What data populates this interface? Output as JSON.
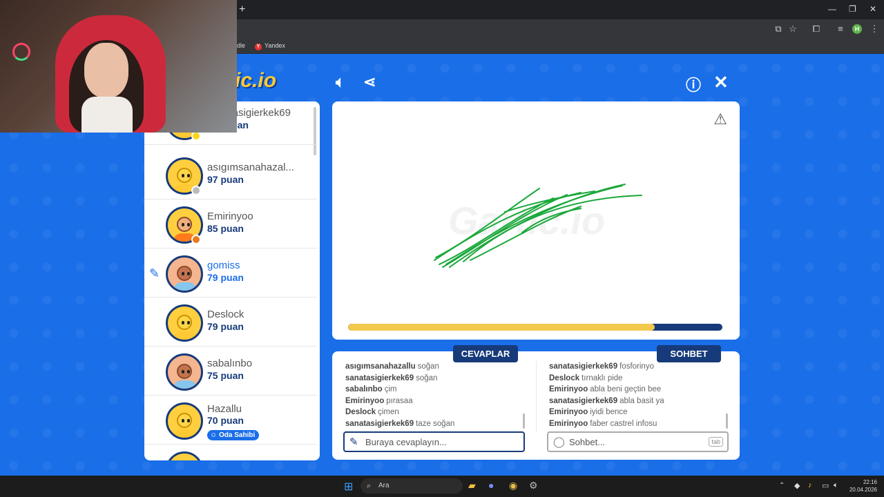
{
  "browser": {
    "bookmarks": [
      "dle",
      "Yandex"
    ],
    "profile_initial": "H"
  },
  "game": {
    "logo": "ic.io",
    "watermark": "Gartic.io",
    "progress_fraction": 0.82
  },
  "players": [
    {
      "name": "sanatasigierkek69",
      "points": "112 puan",
      "status_color": "#ffd51a"
    },
    {
      "name": "asıgımsanahazal...",
      "points": "97 puan",
      "status_color": "#bbbbbb"
    },
    {
      "name": "Emirinyoo",
      "points": "85 puan",
      "status_color": "#e87a1a"
    },
    {
      "name": "gomiss",
      "points": "79 puan",
      "drawing": true
    },
    {
      "name": "Deslock",
      "points": "79 puan"
    },
    {
      "name": "sabalınbo",
      "points": "75 puan"
    },
    {
      "name": "Hazallu",
      "points": "70 puan",
      "badge": "Oda Sahibi"
    }
  ],
  "answers": {
    "tab_label": "CEVAPLAR",
    "placeholder": "Buraya cevaplayın...",
    "messages": [
      {
        "who": "asıgımsanahazallu",
        "text": "soğan"
      },
      {
        "who": "sanatasigierkek69",
        "text": "soğan"
      },
      {
        "who": "sabalınbo",
        "text": "çim"
      },
      {
        "who": "Emirinyoo",
        "text": "pırasaa"
      },
      {
        "who": "Deslock",
        "text": "çimen"
      },
      {
        "who": "sanatasigierkek69",
        "text": "taze soğan"
      }
    ]
  },
  "chat": {
    "tab_label": "SOHBET",
    "placeholder": "Sohbet...",
    "tab_hint": "tab",
    "messages": [
      {
        "who": "sanatasigierkek69",
        "text": "fosforinyo"
      },
      {
        "who": "Deslock",
        "text": "tırnaklı pide"
      },
      {
        "who": "Emirinyoo",
        "text": "abla beni geçtin bee"
      },
      {
        "who": "sanatasigierkek69",
        "text": "abla basit ya"
      },
      {
        "who": "Emirinyoo",
        "text": "iyidi bence"
      },
      {
        "who": "Emirinyoo",
        "text": "faber castrel infosu"
      }
    ]
  },
  "taskbar": {
    "search_label": "Ara",
    "time": "22:16",
    "date": "20.04.2026"
  }
}
